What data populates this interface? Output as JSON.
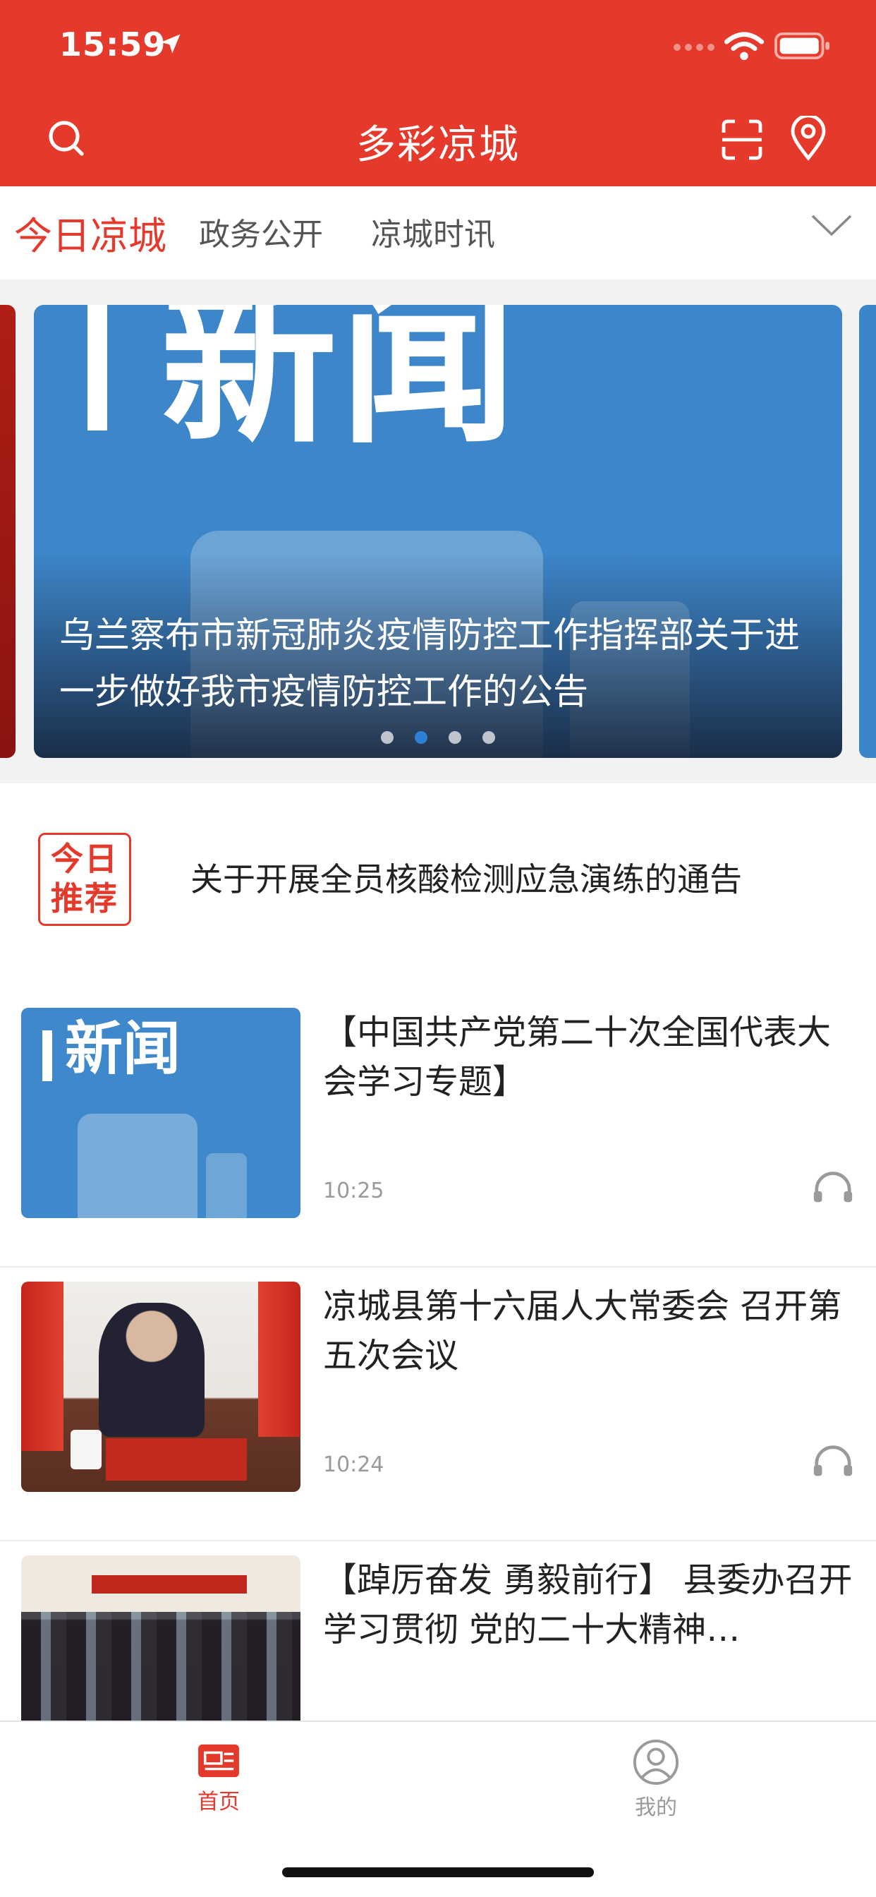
{
  "status_bar": {
    "time": "15:59"
  },
  "header": {
    "title": "多彩凉城"
  },
  "tabs": [
    {
      "label": "今日凉城",
      "active": true
    },
    {
      "label": "政务公开",
      "active": false
    },
    {
      "label": "凉城时讯",
      "active": false
    }
  ],
  "carousel": {
    "image_word": "新闻",
    "caption": "乌兰察布市新冠肺炎疫情防控工作指挥部关于进一步做好我市疫情防控工作的公告",
    "dot_count": 4,
    "active_dot": 2
  },
  "recommend": {
    "badge": "今日推荐",
    "text": "关于开展全员核酸检测应急演练的通告"
  },
  "news": [
    {
      "title": "【中国共产党第二十次全国代表大会学习专题】",
      "time": "10:25",
      "thumb_word": "新闻"
    },
    {
      "title": "凉城县第十六届人大常委会  召开第五次会议",
      "time": "10:24"
    },
    {
      "title": "【踔厉奋发 勇毅前行】  县委办召开学习贯彻  党的二十大精神…",
      "time": ""
    }
  ],
  "bottom_nav": [
    {
      "label": "首页",
      "active": true,
      "icon": "newspaper-icon"
    },
    {
      "label": "我的",
      "active": false,
      "icon": "user-icon"
    }
  ],
  "colors": {
    "brand_red": "#e53a2b",
    "banner_blue": "#3d86c9"
  }
}
